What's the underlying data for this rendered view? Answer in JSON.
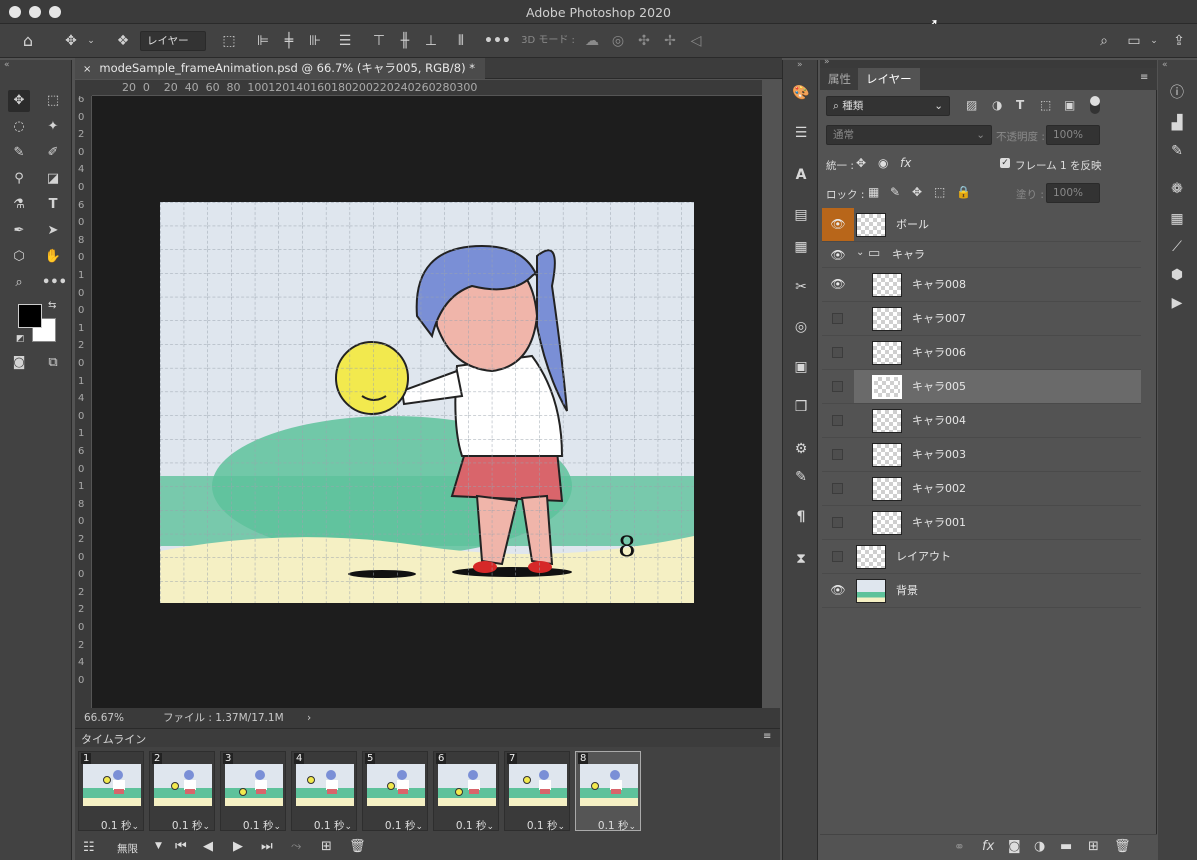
{
  "app": {
    "title": "Adobe Photoshop 2020"
  },
  "options_bar": {
    "layer_select": "レイヤー",
    "mode3d_label": "3D モード :"
  },
  "document": {
    "tab_title": "modeSample_frameAnimation.psd @ 66.7% (キャラ005, RGB/8) *",
    "zoom": "66.67%",
    "file_info": "ファイル : 1.37M/17.1M",
    "h_ruler": [
      "20",
      "0",
      "20",
      "40",
      "60",
      "80",
      "100",
      "120",
      "140",
      "160",
      "180",
      "200",
      "220",
      "240",
      "260",
      "280",
      "300"
    ],
    "v_ruler": [
      "6",
      "0",
      "2",
      "0",
      "4",
      "0",
      "6",
      "0",
      "8",
      "0",
      "1",
      "0",
      "0",
      "1",
      "2",
      "0",
      "1",
      "4",
      "0",
      "1",
      "6",
      "0",
      "1",
      "8",
      "0",
      "2",
      "0",
      "0",
      "2",
      "2",
      "0",
      "2",
      "4",
      "0"
    ],
    "canvas_number": "8"
  },
  "timeline": {
    "title": "タイムライン",
    "loop": "無限",
    "frames": [
      {
        "num": "1",
        "delay": "0.1 秒"
      },
      {
        "num": "2",
        "delay": "0.1 秒"
      },
      {
        "num": "3",
        "delay": "0.1 秒"
      },
      {
        "num": "4",
        "delay": "0.1 秒"
      },
      {
        "num": "5",
        "delay": "0.1 秒"
      },
      {
        "num": "6",
        "delay": "0.1 秒"
      },
      {
        "num": "7",
        "delay": "0.1 秒"
      },
      {
        "num": "8",
        "delay": "0.1 秒"
      }
    ]
  },
  "layers_panel": {
    "tab_properties": "属性",
    "tab_layers": "レイヤー",
    "filter": "種類",
    "blend_mode": "通常",
    "opacity_label": "不透明度 :",
    "opacity": "100%",
    "unify_label": "統一 :",
    "propagate_label": "フレーム 1 を反映",
    "lock_label": "ロック :",
    "fill_label": "塗り :",
    "fill": "100%",
    "layers": [
      {
        "name": "ボール",
        "visible": true
      },
      {
        "name": "キャラ",
        "visible": true,
        "group": true
      },
      {
        "name": "キャラ008",
        "visible": true
      },
      {
        "name": "キャラ007",
        "visible": false
      },
      {
        "name": "キャラ006",
        "visible": false
      },
      {
        "name": "キャラ005",
        "visible": false,
        "active": true
      },
      {
        "name": "キャラ004",
        "visible": false
      },
      {
        "name": "キャラ003",
        "visible": false
      },
      {
        "name": "キャラ002",
        "visible": false
      },
      {
        "name": "キャラ001",
        "visible": false
      },
      {
        "name": "レイアウト",
        "visible": false
      },
      {
        "name": "背景",
        "visible": true
      }
    ]
  },
  "colors": {
    "accent_eye": "#b8661a",
    "foreground": "#000000",
    "background": "#ffffff"
  }
}
